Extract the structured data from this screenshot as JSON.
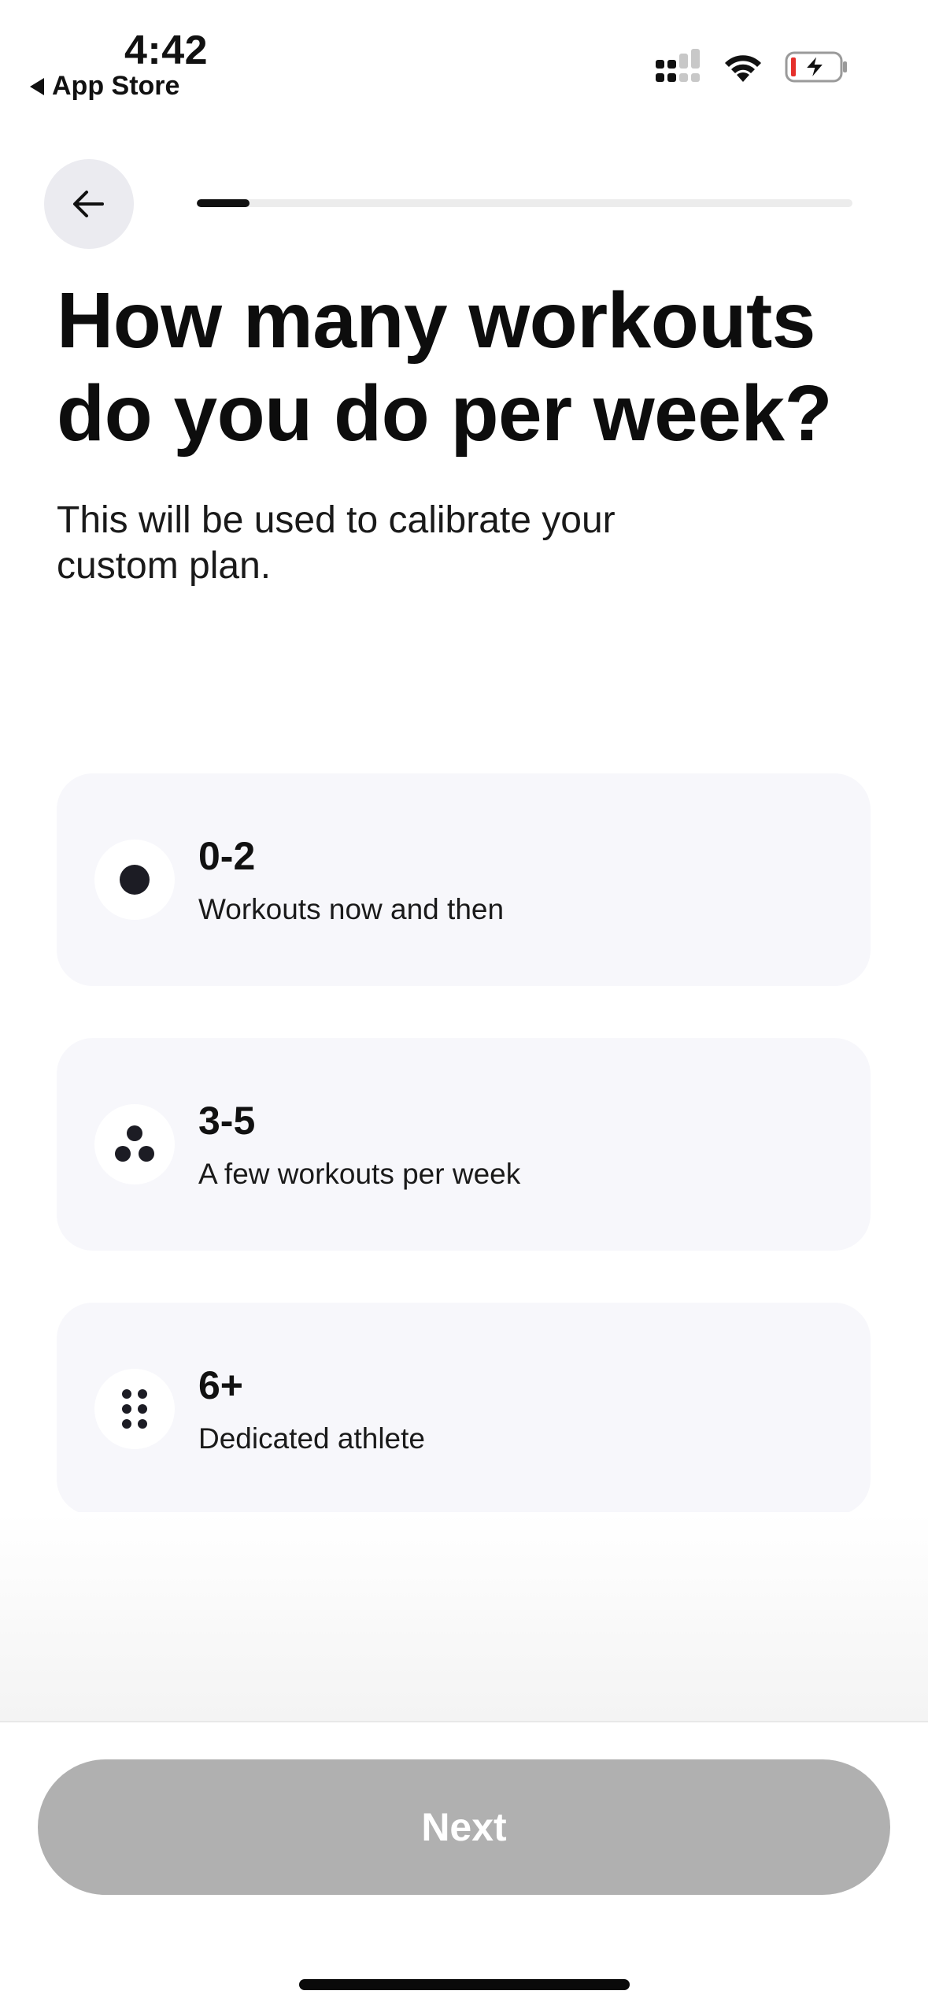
{
  "status_bar": {
    "time": "4:42",
    "back_label": "App Store",
    "icons": [
      "signal-icon",
      "wifi-icon",
      "battery-charging-icon"
    ],
    "battery_low_color": "#e5302b"
  },
  "header": {
    "back_icon": "arrow-left-icon",
    "progress": 0.08
  },
  "main": {
    "title": "How many workouts do you do per week?",
    "subtitle": "This will be used to calibrate your custom plan."
  },
  "options": [
    {
      "icon": "one-dot-icon",
      "label": "0-2",
      "description": "Workouts now and then"
    },
    {
      "icon": "three-dots-icon",
      "label": "3-5",
      "description": "A few workouts per week"
    },
    {
      "icon": "six-dots-icon",
      "label": "6+",
      "description": "Dedicated athlete"
    }
  ],
  "footer": {
    "next_label": "Next",
    "next_color": "#b0b0b0"
  }
}
